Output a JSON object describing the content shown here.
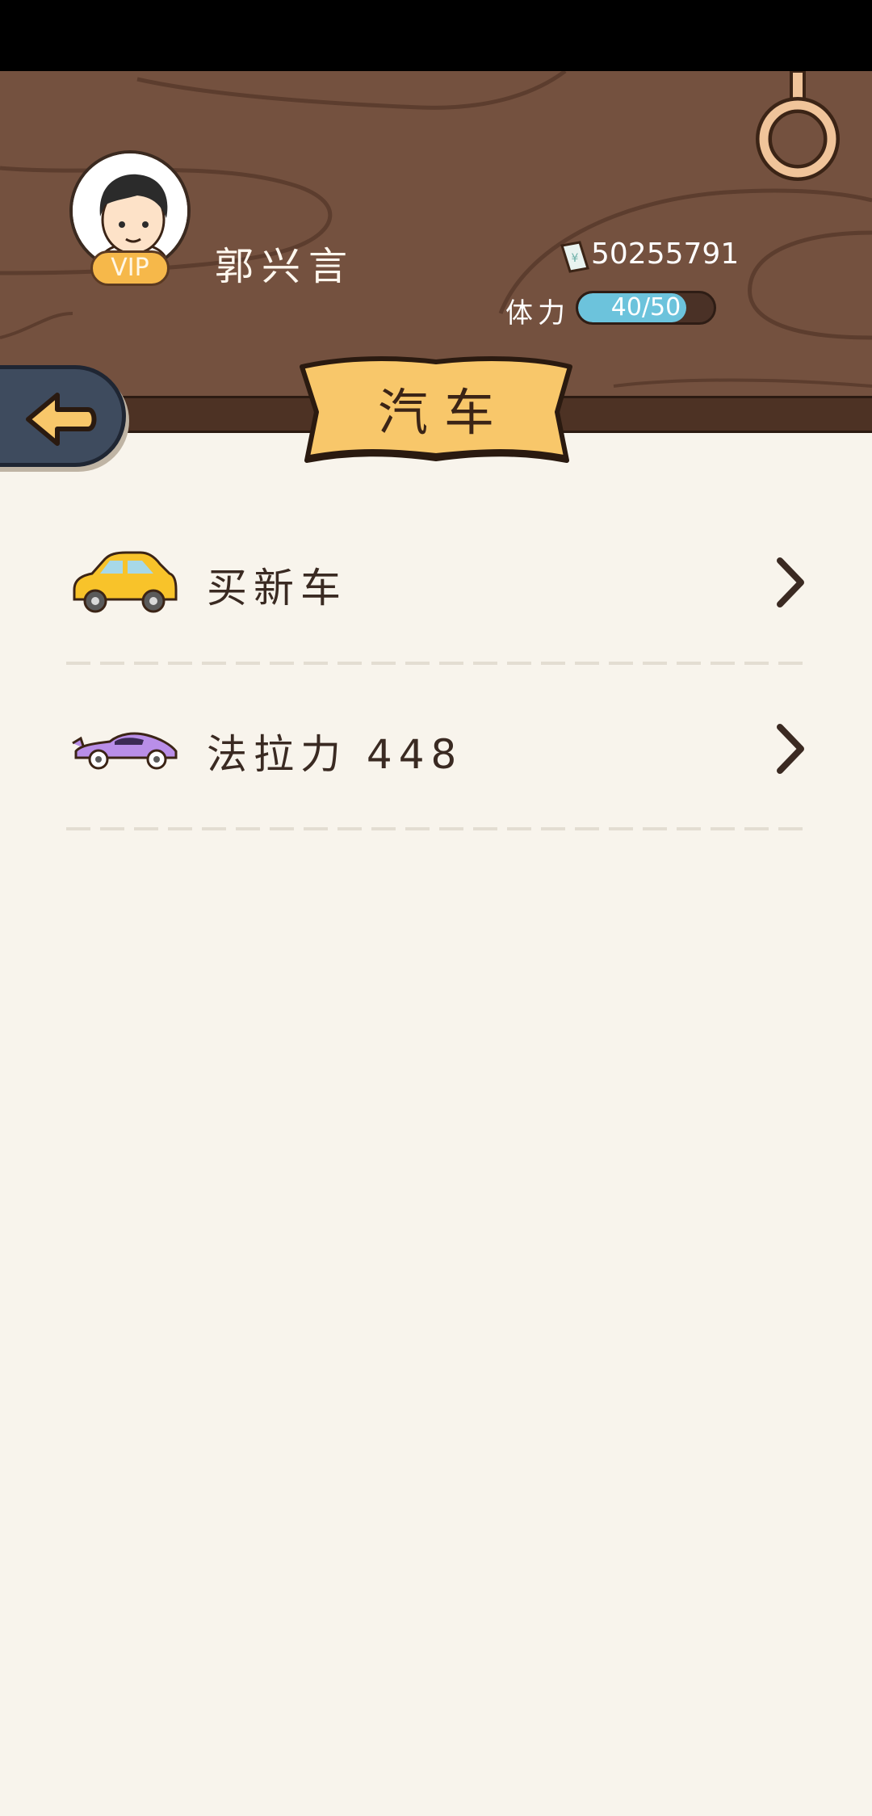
{
  "profile": {
    "name": "郭兴言",
    "vip_label": "VIP",
    "money": "50255791",
    "stamina_label": "体力",
    "stamina_text": "40/50",
    "stamina_fraction": 0.8
  },
  "page": {
    "title": "汽车"
  },
  "list": {
    "items": [
      {
        "label": "买新车",
        "icon": "yellow-car-icon"
      },
      {
        "label": "法拉力 448",
        "icon": "purple-sports-car-icon"
      }
    ]
  },
  "colors": {
    "wood": "#74513f",
    "background": "#f8f4ec",
    "banner": "#f8c76a",
    "back_button": "#3e4b5e",
    "arrow": "#f8c76a",
    "stamina_fill": "#6cc3dc"
  }
}
